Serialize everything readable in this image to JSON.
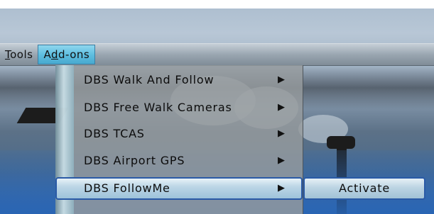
{
  "menubar": {
    "items": [
      {
        "prefix": "",
        "underlined": "T",
        "suffix": "ools"
      },
      {
        "prefix": "A",
        "underlined": "d",
        "suffix": "d-ons"
      }
    ]
  },
  "addons_menu": {
    "items": [
      {
        "label": "DBS Walk And Follow",
        "arrow": "▶"
      },
      {
        "label": "DBS Free Walk Cameras",
        "arrow": "▶"
      },
      {
        "label": "DBS TCAS",
        "arrow": "▶"
      },
      {
        "label": "DBS Airport GPS",
        "arrow": "▶"
      },
      {
        "label": "DBS FollowMe",
        "arrow": "▶"
      }
    ]
  },
  "followme_submenu": {
    "items": [
      {
        "label": "Activate"
      }
    ]
  }
}
